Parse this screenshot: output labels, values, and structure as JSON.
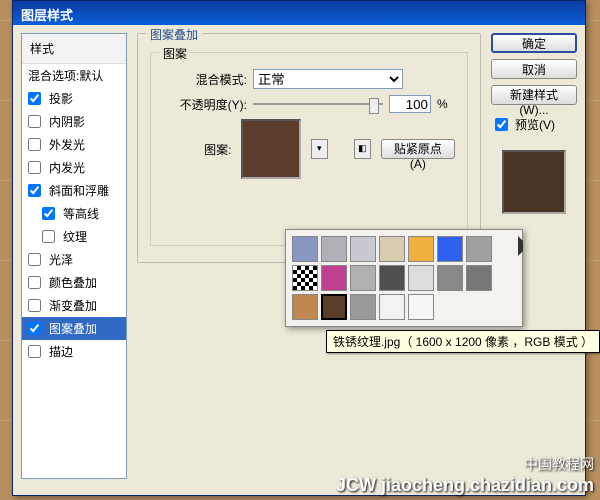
{
  "titlebar": "图层样式",
  "styles": {
    "header": "样式",
    "blend_defaults": "混合选项:默认",
    "items": [
      {
        "label": "投影",
        "checked": true,
        "indent": false
      },
      {
        "label": "内阴影",
        "checked": false,
        "indent": false
      },
      {
        "label": "外发光",
        "checked": false,
        "indent": false
      },
      {
        "label": "内发光",
        "checked": false,
        "indent": false
      },
      {
        "label": "斜面和浮雕",
        "checked": true,
        "indent": false
      },
      {
        "label": "等高线",
        "checked": true,
        "indent": true
      },
      {
        "label": "纹理",
        "checked": false,
        "indent": true
      },
      {
        "label": "光泽",
        "checked": false,
        "indent": false
      },
      {
        "label": "颜色叠加",
        "checked": false,
        "indent": false
      },
      {
        "label": "渐变叠加",
        "checked": false,
        "indent": false
      },
      {
        "label": "图案叠加",
        "checked": true,
        "indent": false,
        "selected": true
      },
      {
        "label": "描边",
        "checked": false,
        "indent": false
      }
    ]
  },
  "center": {
    "section_title": "图案叠加",
    "subsection_title": "图案",
    "blend_mode_label": "混合模式:",
    "blend_mode_value": "正常",
    "opacity_label": "不透明度(Y):",
    "opacity_value": "100",
    "opacity_unit": "%",
    "pattern_label": "图案:",
    "snap_origin": "贴紧原点(A)"
  },
  "popup": {
    "tooltip": "铁锈纹理.jpg（ 1600 x 1200 像素 ，RGB 模式 ）",
    "swatches": [
      "#8896c0",
      "#b0b0b8",
      "#c8c8d0",
      "#d8ccb0",
      "#f0b040",
      "#3060f0",
      "#a0a0a0",
      "#fff",
      "#c04090",
      "#b0b0b0",
      "#505050",
      "#ddd",
      "#888",
      "#777",
      "#c08850",
      "#5a3d2a",
      "#999",
      "#f2f2f2",
      "#f6f6f6",
      "",
      ""
    ],
    "selected_index": 15
  },
  "right": {
    "ok": "确定",
    "cancel": "取消",
    "new_style": "新建样式(W)...",
    "preview_label": "预览(V)",
    "preview_checked": true
  },
  "watermark": {
    "line1": "中国教程网",
    "line2": "JCW jiaocheng.chazidian.com"
  }
}
